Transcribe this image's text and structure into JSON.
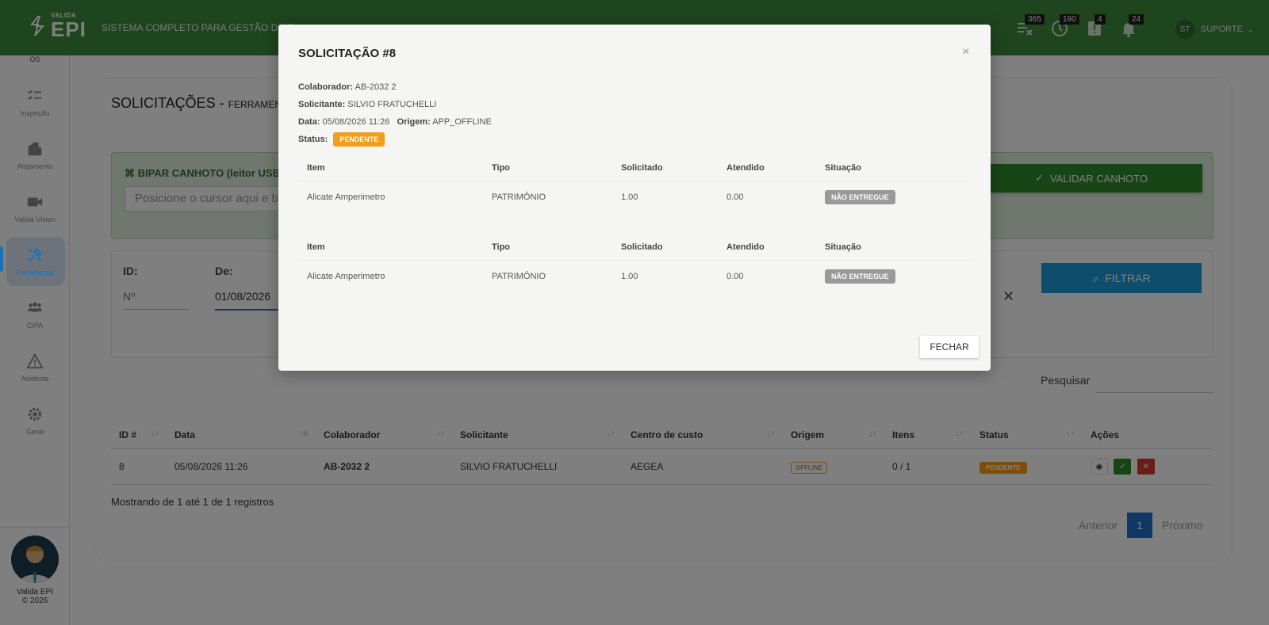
{
  "header": {
    "logo_small": "VALIDA",
    "logo_big": "EPI",
    "system_title": "SISTEMA COMPLETO PARA GESTÃO DE E",
    "notifications": [
      {
        "icon": "list-x-icon",
        "count": "365"
      },
      {
        "icon": "clock-history-icon",
        "count": "190"
      },
      {
        "icon": "alert-box-icon",
        "count": "4"
      },
      {
        "icon": "bell-icon",
        "count": "24"
      }
    ],
    "user_initials": "ST",
    "user_name": "SUPORTE"
  },
  "sidebar": {
    "top_partial": "OS",
    "items": [
      {
        "label": "Inspeção",
        "icon": "checklist-icon"
      },
      {
        "label": "Alojamento",
        "icon": "building-icon"
      },
      {
        "label": "Valida Vision",
        "icon": "video-camera-icon"
      },
      {
        "label": "Ferramenta",
        "icon": "tools-icon",
        "active": true
      },
      {
        "label": "CIPA",
        "icon": "users-group-icon"
      },
      {
        "label": "Acidente",
        "icon": "warning-icon"
      },
      {
        "label": "Geral",
        "icon": "gear-icon"
      }
    ],
    "footer_name": "Valida EPI",
    "footer_copy": "© 2026"
  },
  "page": {
    "title": "SOLICITAÇÕES - ",
    "title_small": "FERRAMENTA",
    "scan_label": "BIPAR CANHOTO (leitor USB",
    "scan_placeholder": "Posicione o cursor aqui e b",
    "validar_label": "VALIDAR CANHOTO",
    "filter": {
      "id_label": "ID:",
      "id_placeholder": "Nº",
      "de_label": "De:",
      "de_value": "01/08/2026"
    },
    "filtrar_label": "FILTRAR",
    "search_label": "Pesquisar",
    "table": {
      "headers": [
        "ID #",
        "Data",
        "Colaborador",
        "Solicitante",
        "Centro de custo",
        "Origem",
        "Itens",
        "Status",
        "Ações"
      ],
      "rows": [
        {
          "id": "8",
          "data": "05/08/2026 11:26",
          "colaborador": "AB-2032 2",
          "solicitante": "SILVIO FRATUCHELLI",
          "centro": "AEGEA",
          "origem": "OFFLINE",
          "itens": "0 / 1",
          "status": "PENDENTE"
        }
      ]
    },
    "showing": "Mostrando de 1 até 1 de 1 registros",
    "pager": {
      "prev": "Anterior",
      "page": "1",
      "next": "Próximo"
    }
  },
  "modal": {
    "title": "SOLICITAÇÃO #8",
    "close": "×",
    "colaborador_label": "Colaborador:",
    "colaborador": "AB-2032 2",
    "solicitante_label": "Solicitante:",
    "solicitante": "SILVIO FRATUCHELLI",
    "data_label": "Data:",
    "data": "05/08/2026 11:26",
    "origem_label": "Origem:",
    "origem": "APP_OFFLINE",
    "status_label": "Status:",
    "status": "PENDENTE",
    "item_headers": [
      "Item",
      "Tipo",
      "Solicitado",
      "Atendido",
      "Situação"
    ],
    "items": [
      {
        "item": "Alicate Amperimetro",
        "tipo": "PATRIMÔNIO",
        "solicitado": "1.00",
        "atendido": "0.00",
        "situacao": "NÃO ENTREGUE"
      },
      {
        "item": "Alicate Amperimetro",
        "tipo": "PATRIMÔNIO",
        "solicitado": "1.00",
        "atendido": "0.00",
        "situacao": "NÃO ENTREGUE"
      }
    ],
    "fechar_label": "FECHAR"
  }
}
